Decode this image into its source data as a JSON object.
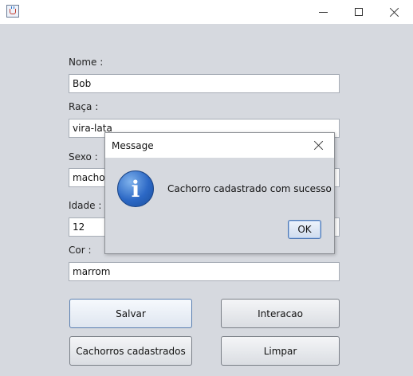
{
  "window": {
    "title": "",
    "controls": {
      "minimize_icon": "minimize-icon",
      "maximize_icon": "maximize-icon",
      "close_icon": "close-icon"
    }
  },
  "form": {
    "nome": {
      "label": "Nome :",
      "value": "Bob"
    },
    "raca": {
      "label": "Raça :",
      "value": "vira-lata"
    },
    "sexo": {
      "label": "Sexo :",
      "value": "macho"
    },
    "idade": {
      "label": "Idade :",
      "value": "12"
    },
    "cor": {
      "label": "Cor :",
      "value": "marrom"
    }
  },
  "buttons": {
    "salvar": "Salvar",
    "interacao": "Interacao",
    "cadastrados": "Cachorros cadastrados",
    "limpar": "Limpar"
  },
  "dialog": {
    "title": "Message",
    "icon": "information-icon",
    "icon_glyph": "i",
    "message": "Cachorro cadastrado com sucesso",
    "ok_label": "OK"
  },
  "colors": {
    "background": "#d6d9df",
    "info_icon": "#2c68c5",
    "focus_border": "#4d78b5"
  }
}
